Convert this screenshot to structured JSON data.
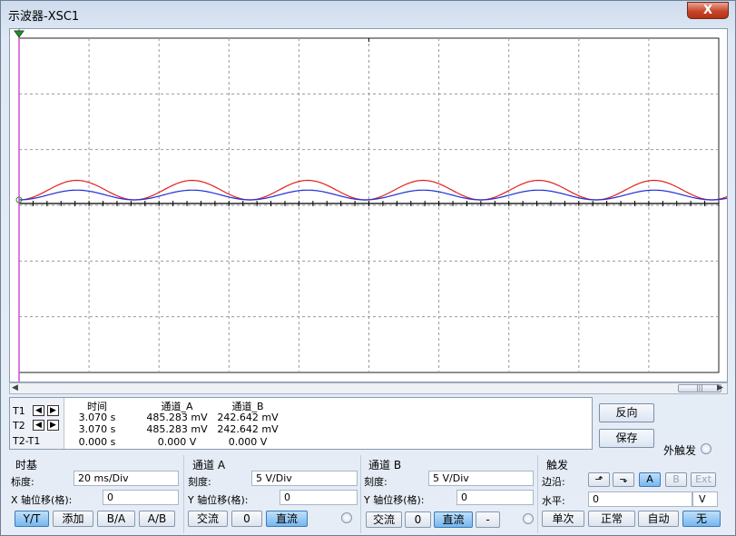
{
  "window": {
    "title": "示波器-XSC1",
    "close_glyph": "X"
  },
  "scroll": {
    "left_arrow": "◀",
    "right_arrow": "▶",
    "thumb_grip": "|||"
  },
  "readout": {
    "headers": [
      "时间",
      "通道_A",
      "通道_B"
    ],
    "rows": [
      {
        "label": "T1",
        "time": "3.070 s",
        "a": "485.283 mV",
        "b": "242.642 mV"
      },
      {
        "label": "T2",
        "time": "3.070 s",
        "a": "485.283 mV",
        "b": "242.642 mV"
      },
      {
        "label": "T2-T1",
        "time": "0.000 s",
        "a": "0.000 V",
        "b": "0.000 V"
      }
    ],
    "arrow_left": "◀",
    "arrow_right": "▶"
  },
  "side": {
    "reverse": "反向",
    "save": "保存",
    "ext_trigger": "外触发"
  },
  "timebase": {
    "title": "时基",
    "scale_label": "标度:",
    "scale_value": "20 ms/Div",
    "xpos_label": "X 轴位移(格):",
    "xpos_value": "0",
    "buttons": {
      "yt": "Y/T",
      "add": "添加",
      "ba": "B/A",
      "ab": "A/B"
    }
  },
  "channel_a": {
    "title": "通道 A",
    "scale_label": "刻度:",
    "scale_value": "5  V/Div",
    "ypos_label": "Y 轴位移(格):",
    "ypos_value": "0",
    "buttons": {
      "ac": "交流",
      "zero": "0",
      "dc": "直流"
    }
  },
  "channel_b": {
    "title": "通道 B",
    "scale_label": "刻度:",
    "scale_value": "5  V/Div",
    "ypos_label": "Y 轴位移(格):",
    "ypos_value": "0",
    "buttons": {
      "ac": "交流",
      "zero": "0",
      "dc": "直流",
      "minus": "-"
    }
  },
  "trigger": {
    "title": "触发",
    "edge_label": "边沿:",
    "level_label": "水平:",
    "level_value": "0",
    "level_unit": "V",
    "edge_rise": "⬏",
    "edge_fall": "⬎",
    "src_a": "A",
    "src_b": "B",
    "src_ext": "Ext",
    "buttons": {
      "single": "单次",
      "normal": "正常",
      "auto": "自动",
      "none": "无"
    }
  },
  "colors": {
    "channel_a": "#e0201c",
    "channel_b": "#1f2fd6",
    "cursor": "#d64fd6",
    "active_button": "#76b7ee"
  },
  "chart_data": {
    "type": "line",
    "xlabel": "",
    "ylabel": "",
    "x_unit": "ms",
    "x_div": 20,
    "x_divisions": 10,
    "y_unit": "V",
    "y_div": 5,
    "y_divisions": 6,
    "series": [
      {
        "color": "#e0201c",
        "period_ms": 10,
        "peak_v": 5.0,
        "cycles": 9
      },
      {
        "color": "#1f2fd6",
        "period_ms": 10,
        "peak_v": 2.5,
        "cycles": 9
      }
    ]
  }
}
